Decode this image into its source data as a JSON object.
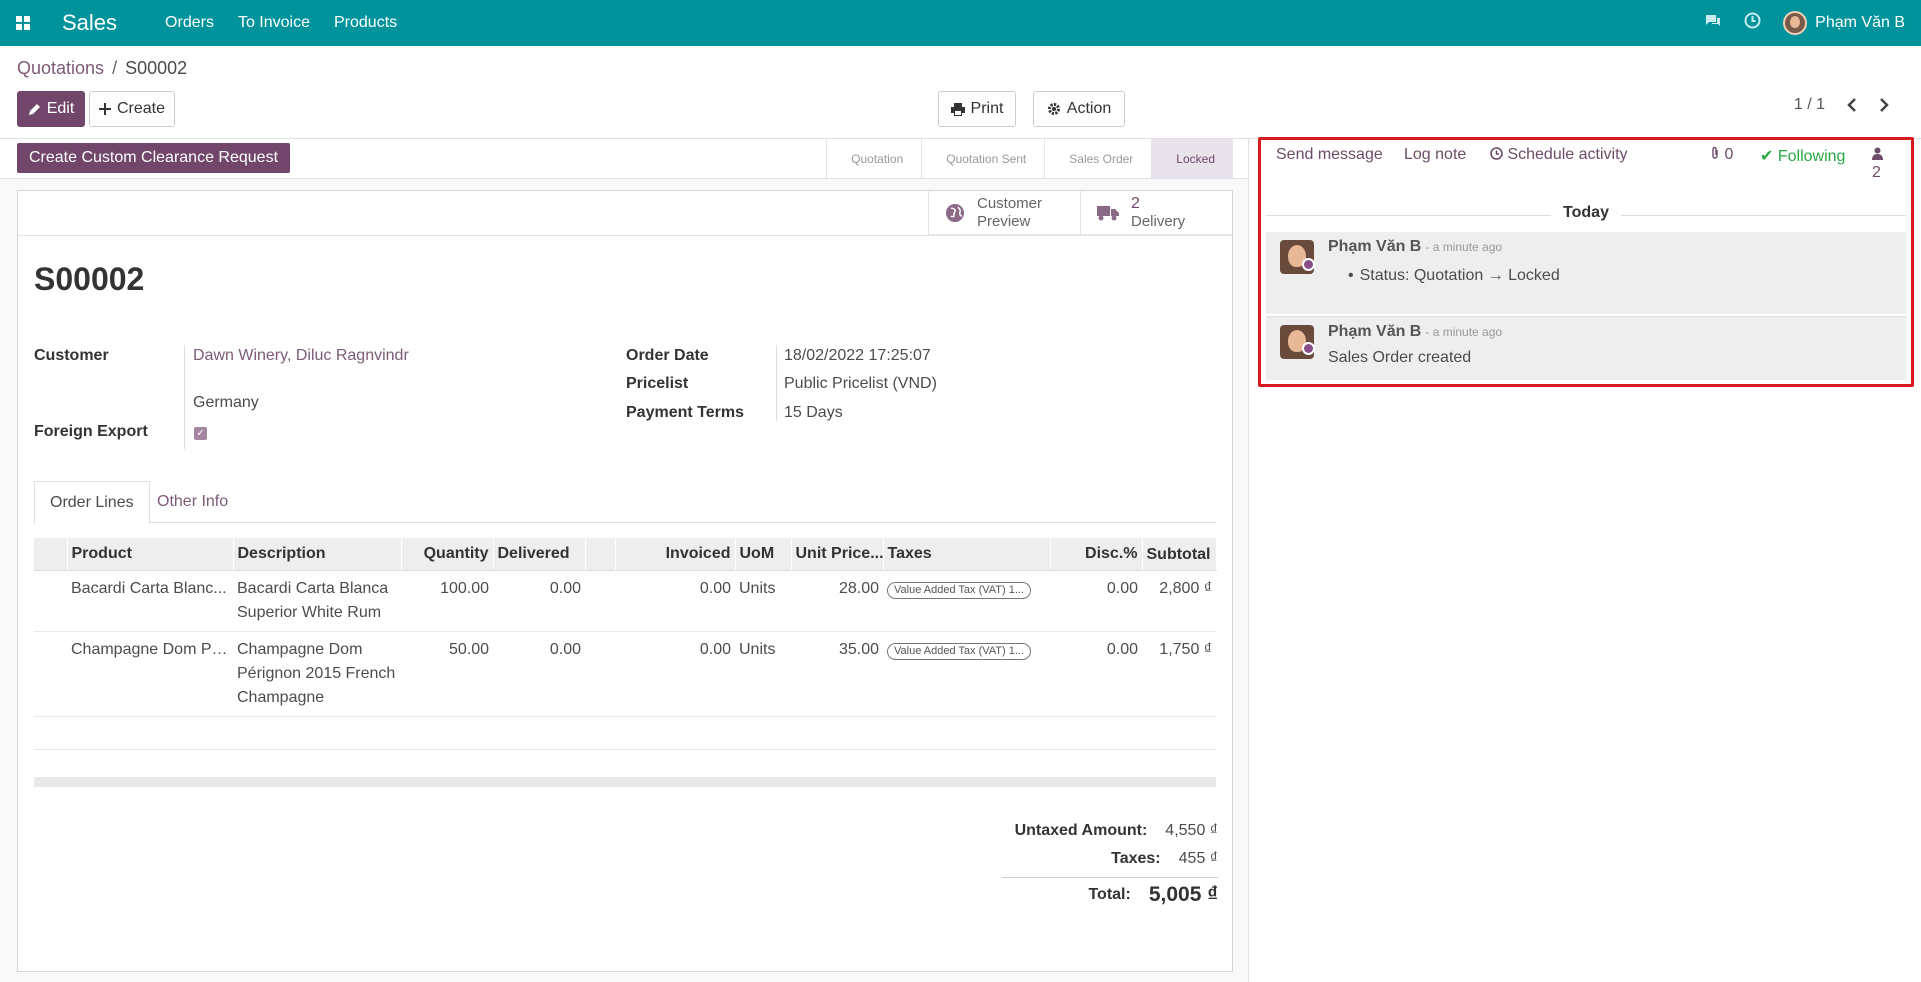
{
  "nav": {
    "app_name": "Sales",
    "menu": [
      "Orders",
      "To Invoice",
      "Products"
    ],
    "user": "Phạm Văn B"
  },
  "breadcrumb": {
    "parent": "Quotations",
    "current": "S00002"
  },
  "toolbar": {
    "edit": "Edit",
    "create": "Create",
    "print": "Print",
    "action": "Action",
    "pager": "1 / 1"
  },
  "statusbar": {
    "custom_button": "Create Custom Clearance Request",
    "stages": [
      "Quotation",
      "Quotation Sent",
      "Sales Order",
      "Locked"
    ],
    "active_stage": "Locked"
  },
  "smart_buttons": {
    "preview_line1": "Customer",
    "preview_line2": "Preview",
    "delivery_count": "2",
    "delivery_label": "Delivery"
  },
  "order": {
    "name": "S00002",
    "customer_label": "Customer",
    "customer": "Dawn Winery, Diluc Ragnvindr",
    "customer_country": "Germany",
    "foreign_export_label": "Foreign Export",
    "foreign_export": true,
    "order_date_label": "Order Date",
    "order_date": "18/02/2022 17:25:07",
    "pricelist_label": "Pricelist",
    "pricelist": "Public Pricelist (VND)",
    "payment_terms_label": "Payment Terms",
    "payment_terms": "15 Days"
  },
  "tabs": [
    "Order Lines",
    "Other Info"
  ],
  "lines": {
    "headers": [
      "Product",
      "Description",
      "Quantity",
      "Delivered",
      "Invoiced",
      "UoM",
      "Unit Price...",
      "Taxes",
      "Disc.%",
      "Subtotal"
    ],
    "rows": [
      {
        "product": "Bacardi Carta Blanc...",
        "description": "Bacardi Carta Blanca Superior White Rum",
        "quantity": "100.00",
        "delivered": "0.00",
        "invoiced": "0.00",
        "uom": "Units",
        "unit_price": "28.00",
        "taxes": "Value Added Tax (VAT) 1...",
        "discount": "0.00",
        "subtotal": "2,800 ₫"
      },
      {
        "product": "Champagne Dom Pé...",
        "description": "Champagne Dom Pérignon 2015 French Champagne",
        "quantity": "50.00",
        "delivered": "0.00",
        "invoiced": "0.00",
        "uom": "Units",
        "unit_price": "35.00",
        "taxes": "Value Added Tax (VAT) 1...",
        "discount": "0.00",
        "subtotal": "1,750 ₫"
      }
    ]
  },
  "totals": {
    "untaxed_label": "Untaxed Amount:",
    "untaxed": "4,550 ₫",
    "taxes_label": "Taxes:",
    "taxes": "455 ₫",
    "total_label": "Total:",
    "total": "5,005 ₫"
  },
  "chatter": {
    "send_message": "Send message",
    "log_note": "Log note",
    "schedule_activity": "Schedule activity",
    "attachments": "0",
    "following": "Following",
    "followers": "2",
    "today": "Today",
    "messages": [
      {
        "author": "Phạm Văn B",
        "time": "- a minute ago",
        "body": "Status: Quotation → Locked"
      },
      {
        "author": "Phạm Văn B",
        "time": "- a minute ago",
        "body": "Sales Order created"
      }
    ]
  },
  "colors": {
    "navbar": "#00939c",
    "primary": "#71466a",
    "link": "#7c5a78",
    "following": "#28a745",
    "highlight_box": "#d71920"
  }
}
